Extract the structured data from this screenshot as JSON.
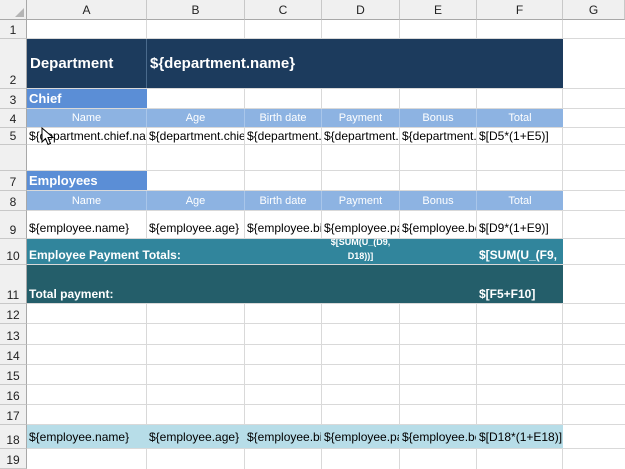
{
  "columns": [
    "A",
    "B",
    "C",
    "D",
    "E",
    "F",
    "G"
  ],
  "rows": [
    "1",
    "2",
    "3",
    "4",
    "5",
    "7",
    "8",
    "9",
    "10",
    "11",
    "12",
    "13",
    "14",
    "15",
    "16",
    "17",
    "18",
    "19"
  ],
  "colors": {
    "dark_navy": "#1c3b5d",
    "section_blue": "#5b8ed6",
    "header_blue": "#8db3e2",
    "teal": "#31859c",
    "dark_teal": "#245e6a",
    "light_cyan": "#b7dde8"
  },
  "cells": {
    "department_label": "Department",
    "department_name": "${department.name}",
    "chief_label": "Chief",
    "header_name": "Name",
    "header_age": "Age",
    "header_birth": "Birth date",
    "header_payment": "Payment",
    "header_bonus": "Bonus",
    "header_total": "Total",
    "chief_name": "${department.chief.name}",
    "chief_age": "${department.chief.age}",
    "chief_birth": "${department.chief.birthDate}",
    "chief_payment": "${department.chief.payment}",
    "chief_bonus": "${department.chief.bonus}",
    "chief_total": "$[D5*(1+E5)]",
    "employees_label": "Employees",
    "emp_name": "${employee.name}",
    "emp_age": "${employee.age}",
    "emp_birth": "${employee.birthDate}",
    "emp_payment": "${employee.payment}",
    "emp_bonus": "${employee.bonus}",
    "emp_total": "$[D9*(1+E9)]",
    "totals_label": "Employee Payment Totals:",
    "totals_payment_line1": "$[SUM(U_(D9,",
    "totals_payment_line2": "D18))]",
    "totals_total": "$[SUM(U_(F9,",
    "total_payment_label": "Total payment:",
    "total_payment_value": "$[F5+F10]",
    "r18_name": "${employee.name}",
    "r18_age": "${employee.age}",
    "r18_birth": "${employee.birthDate}",
    "r18_payment": "${employee.payment}",
    "r18_bonus": "${employee.bonus}",
    "r18_total": "$[D18*(1+E18)]"
  }
}
